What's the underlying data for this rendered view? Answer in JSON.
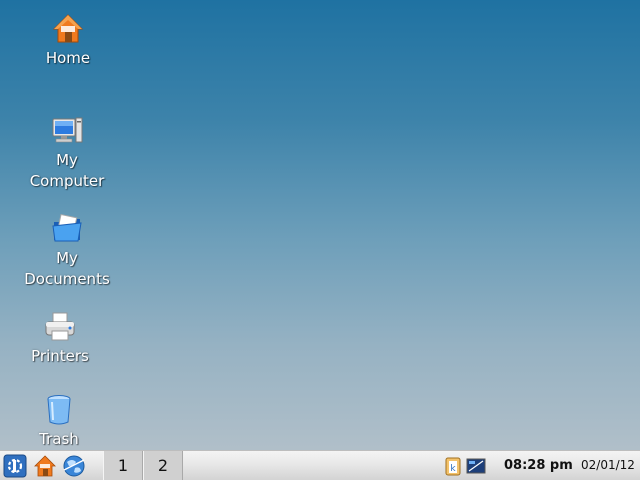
{
  "desktop": {
    "icons": [
      {
        "label_line1": "Home",
        "icon": "home-icon"
      },
      {
        "label_line1": "My",
        "label_line2": "Computer",
        "icon": "computer-icon"
      },
      {
        "label_line1": "My",
        "label_line2": "Documents",
        "icon": "documents-folder-icon"
      },
      {
        "label_line1": "Printers",
        "icon": "printer-icon"
      },
      {
        "label_line1": "Trash",
        "icon": "trash-icon"
      }
    ]
  },
  "taskbar": {
    "launchers": [
      "kde-menu-icon",
      "home-icon",
      "web-browser-icon"
    ],
    "desktops": [
      "1",
      "2"
    ],
    "tray": [
      "klipper-icon",
      "display-icon"
    ],
    "clock": {
      "time": "08:28 pm",
      "date": "02/01/12"
    }
  },
  "colors": {
    "desktop_top": "#1f72a2",
    "desktop_bottom": "#b8c3cb",
    "taskbar": "#e6e6e6"
  }
}
